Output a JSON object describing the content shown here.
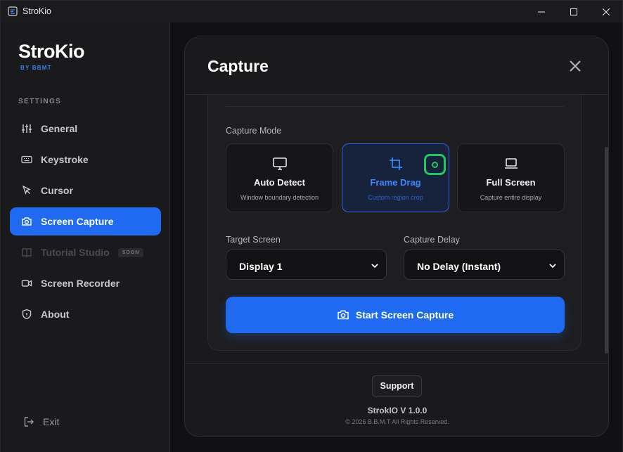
{
  "window": {
    "title": "StroKio"
  },
  "sidebar": {
    "brand": "StroKio",
    "brand_sub": "BY BBMT",
    "section": "SETTINGS",
    "items": [
      {
        "label": "General",
        "icon": "sliders-icon"
      },
      {
        "label": "Keystroke",
        "icon": "keyboard-icon"
      },
      {
        "label": "Cursor",
        "icon": "cursor-icon"
      },
      {
        "label": "Screen Capture",
        "icon": "camera-icon",
        "active": true
      },
      {
        "label": "Tutorial Studio",
        "icon": "book-icon",
        "disabled": true,
        "badge": "SOON"
      },
      {
        "label": "Screen Recorder",
        "icon": "video-icon"
      },
      {
        "label": "About",
        "icon": "shield-icon"
      }
    ],
    "exit": "Exit"
  },
  "modal": {
    "title": "Capture",
    "capture_mode_label": "Capture Mode",
    "modes": [
      {
        "title": "Auto Detect",
        "desc": "Window boundary detection",
        "icon": "monitor-icon"
      },
      {
        "title": "Frame Drag",
        "desc": "Custom region crop",
        "icon": "crop-icon",
        "selected": true
      },
      {
        "title": "Full Screen",
        "desc": "Capture entire display",
        "icon": "laptop-icon"
      }
    ],
    "target_screen_label": "Target Screen",
    "target_screen_value": "Display 1",
    "capture_delay_label": "Capture Delay",
    "capture_delay_value": "No Delay (Instant)",
    "start_label": "Start Screen Capture",
    "support_label": "Support",
    "version": "StrokIO V 1.0.0",
    "copyright": "© 2026 B.B.M.T All Rights Reserved."
  },
  "colors": {
    "accent": "#1f6af0",
    "selected_badge": "#22c55e",
    "background": "#151517"
  }
}
